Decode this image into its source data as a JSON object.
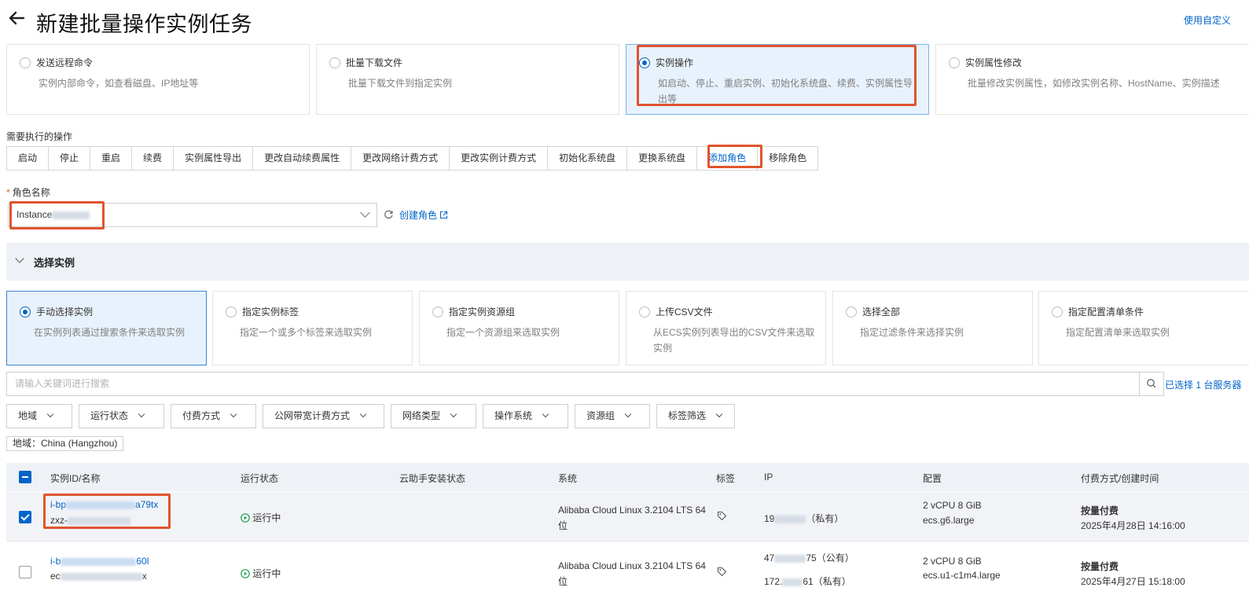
{
  "header": {
    "title": "新建批量操作实例任务",
    "top_link": "使用自定义"
  },
  "task_types": [
    {
      "title": "发送远程命令",
      "desc": "实例内部命令，如查看磁盘、IP地址等",
      "selected": false
    },
    {
      "title": "批量下载文件",
      "desc": "批量下载文件到指定实例",
      "selected": false
    },
    {
      "title": "实例操作",
      "desc": "如启动、停止、重启实例、初始化系统盘、续费、实例属性导出等",
      "selected": true
    },
    {
      "title": "实例属性修改",
      "desc": "批量修改实例属性，如修改实例名称、HostName、实例描述",
      "selected": false
    }
  ],
  "operations": {
    "label": "需要执行的操作",
    "items": [
      "启动",
      "停止",
      "重启",
      "续费",
      "实例属性导出",
      "更改自动续费属性",
      "更改网络计费方式",
      "更改实例计费方式",
      "初始化系统盘",
      "更换系统盘",
      "添加角色",
      "移除角色"
    ],
    "active": "添加角色"
  },
  "role": {
    "required_mark": "*",
    "label": "角色名称",
    "value": "Instance",
    "create_link": "创建角色"
  },
  "select_section": {
    "title": "选择实例",
    "modes": [
      {
        "title": "手动选择实例",
        "desc": "在实例列表通过搜索条件来选取实例",
        "selected": true
      },
      {
        "title": "指定实例标签",
        "desc": "指定一个或多个标签来选取实例",
        "selected": false
      },
      {
        "title": "指定实例资源组",
        "desc": "指定一个资源组来选取实例",
        "selected": false
      },
      {
        "title": "上传CSV文件",
        "desc": "从ECS实例列表导出的CSV文件来选取实例",
        "selected": false
      },
      {
        "title": "选择全部",
        "desc": "指定过滤条件来选择实例",
        "selected": false
      },
      {
        "title": "指定配置清单条件",
        "desc": "指定配置清单来选取实例",
        "selected": false
      }
    ]
  },
  "search": {
    "placeholder": "请输入关键词进行搜索",
    "selected_count": "已选择 1 台服务器"
  },
  "filters": [
    "地域",
    "运行状态",
    "付费方式",
    "公网带宽计费方式",
    "网络类型",
    "操作系统",
    "资源组",
    "标签筛选"
  ],
  "region_tag": "地域：China (Hangzhou)",
  "table": {
    "columns": [
      "实例ID/名称",
      "运行状态",
      "云助手安装状态",
      "系统",
      "标签",
      "IP",
      "配置",
      "付费方式/创建时间"
    ],
    "rows": [
      {
        "checked": true,
        "id_prefix": "i-bp",
        "id_suffix": "a79tx",
        "name_prefix": "zxz-",
        "status": "运行中",
        "os_line1": "Alibaba Cloud Linux 3.2104 LTS 64",
        "os_line2": "位",
        "ip_lines": [
          {
            "prefix": "19",
            "suffix": "",
            "kind": "（私有）"
          }
        ],
        "spec_line1": "2 vCPU 8 GiB",
        "spec_line2": "ecs.g6.large",
        "billing": "按量付费",
        "created": "2025年4月28日 14:16:00"
      },
      {
        "checked": false,
        "id_prefix": "i-b",
        "id_suffix": "60l",
        "name_prefix": "ec",
        "name_suffix": "x",
        "status": "运行中",
        "os_line1": "Alibaba Cloud Linux 3.2104 LTS 64",
        "os_line2": "位",
        "ip_lines": [
          {
            "prefix": "47",
            "suffix": "75",
            "kind": "（公有）"
          },
          {
            "prefix": "172.",
            "suffix": "61",
            "kind": "（私有）"
          }
        ],
        "spec_line1": "2 vCPU 8 GiB",
        "spec_line2": "ecs.u1-c1m4.large",
        "billing": "按量付费",
        "created": "2025年4月27日 15:18:00"
      }
    ]
  },
  "colors": {
    "accent": "#0064c8",
    "highlight": "#e0542e",
    "active_card_bg": "#e8f2fc",
    "status_green": "#1aa34a"
  }
}
